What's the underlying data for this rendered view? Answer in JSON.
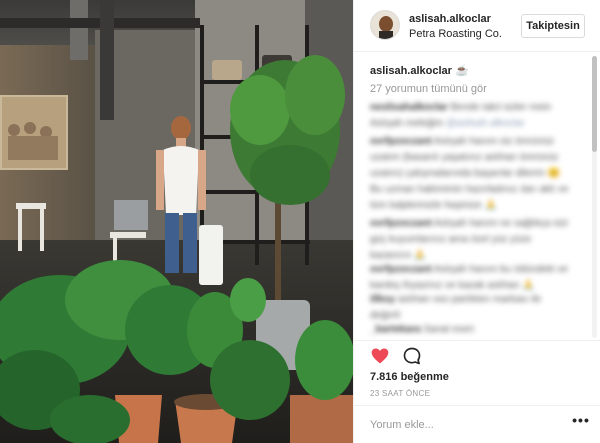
{
  "post": {
    "photo_icon": "photo-plants-woman",
    "header": {
      "username": "aslisah.alkoclar",
      "location": "Petra Roasting Co.",
      "follow_label": "Takiptesin"
    },
    "caption": {
      "username": "aslisah.alkoclar",
      "text": "☕️"
    },
    "view_all_comments": "27 yorumun tümünü gör",
    "blurred_comments": [
      {
        "user": "neslisahalkoclar",
        "text": "Bende takıl sizler mein Aslışah meleğim",
        "mention": "@aslisah.alkoclar"
      },
      {
        "user": "ovrfpzoczant",
        "text": "Aslışah hanım siz ömrünüz uzatım (basarılı yaşatınız aslıhan ömrünüz uzatını) çalışmalarında başarılar dilerim 😊 Bu uzman hakimimin hazırladınız ıları aklı ve tüm kalplerinizle hepinize 🙏",
        "mention": ""
      },
      {
        "user": "ovrfpzoczant",
        "text": "Aslışah hanım ne sağlıkça sizi güç kuyumlarınız ama özel yüz yüze kazanırın 🙏",
        "mention": ""
      },
      {
        "user": "ovrfpzoczant",
        "text": "Aslışah hanım bu ödündeki ve kardeş ihyazmız ve kazak aslıhan 🙏",
        "mention": ""
      },
      {
        "user": "illksy",
        "text": "aslıhan oso parlıkten markası ile değerli",
        "mention": ""
      },
      {
        "user": "_bartekara",
        "text": "Sanat eseri",
        "mention": ""
      }
    ],
    "likes": "7.816 beğenme",
    "timestamp": "23 SAAT ÖNCE",
    "comment_placeholder": "Yorum ekle...",
    "more_label": "•••",
    "icons": {
      "avatar": "avatar-photo",
      "like": "heart-filled-icon",
      "comment": "comment-bubble-icon",
      "more": "more-options-icon"
    },
    "colors": {
      "heart": "#ed4956",
      "link": "#003569",
      "muted": "#999999"
    }
  }
}
